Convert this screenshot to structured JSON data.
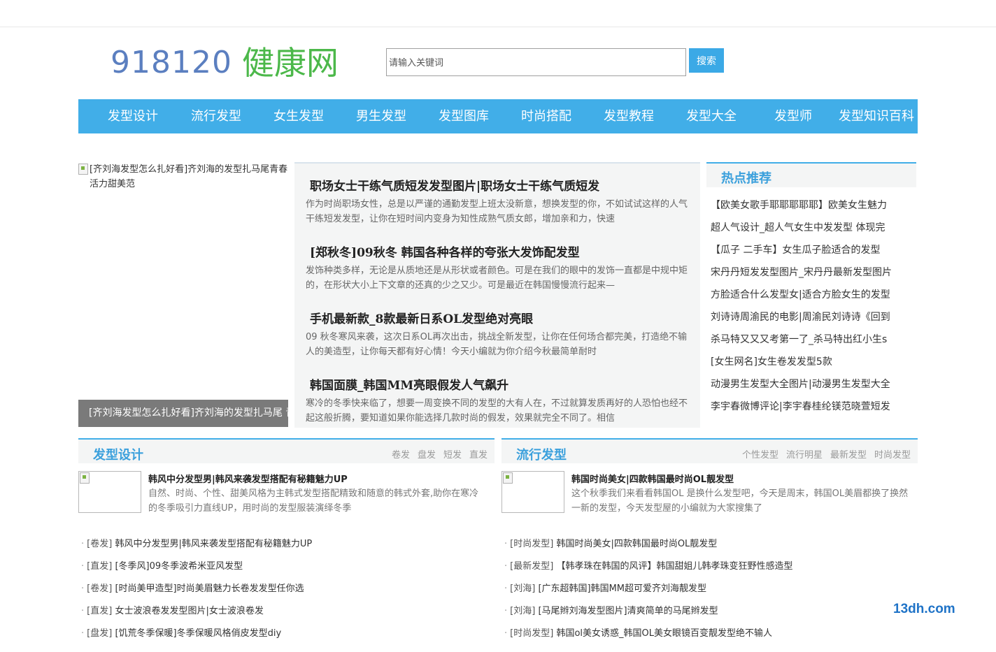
{
  "header": {
    "logo_number": "918120",
    "logo_text": "健康网",
    "search_placeholder": "请输入关键词",
    "search_button": "搜索"
  },
  "nav": {
    "items": [
      "发型设计",
      "流行发型",
      "女生发型",
      "男生发型",
      "发型图库",
      "时尚搭配",
      "发型教程",
      "发型大全",
      "发型师",
      "发型知识百科"
    ]
  },
  "slide": {
    "image_alt": "[齐刘海发型怎么扎好看]齐刘海的发型扎马尾青春活力甜美范",
    "caption": "[齐刘海发型怎么扎好看]齐刘海的发型扎马尾 青春活力甜美范"
  },
  "center": {
    "articles": [
      {
        "title": "职场女士干练气质短发发型图片|职场女士干练气质短发",
        "desc": "作为时尚职场女性，总是以严谨的通勤发型上班太没新意，想换发型的你，不如试试这样的人气干练短发发型，让你在短时间内变身为知性成熟气质女郎，增加亲和力，快速"
      },
      {
        "title": "[郑秋冬]09秋冬 韩国各种各样的夸张大发饰配发型",
        "desc": "发饰种类多样，无论是从质地还是从形状或者颜色。可是在我们的眼中的发饰一直都是中规中矩的，在形状大小上下文章的还真的少之又少。可是最近在韩国慢慢流行起来—"
      },
      {
        "title": "手机最新款_8款最新日系OL发型绝对亮眼",
        "desc": "09 秋冬寒风来袭，这次日系OL再次出击，挑战全新发型，让你在任何场合都完美，打造绝不输人的美造型，让你每天都有好心情！今天小编就为你介绍今秋最简单耐时"
      },
      {
        "title": "韩国面膜_韩国MM亮眼假发人气飙升",
        "desc": "寒冷的冬季快来临了，想要一周变换不同的发型的大有人在，不过就算发质再好的人恐怕也经不起这般折腾，要知道如果你能选择几款时尚的假发，效果就完全不同了。相信"
      }
    ]
  },
  "hot": {
    "title": "热点推荐",
    "items": [
      "【欧美女歌手耶耶耶耶耶】欧美女生魅力",
      "超人气设计_超人气女生中发发型 体现完",
      "【瓜子 二手车】女生瓜子脸适合的发型",
      "宋丹丹短发发型图片_宋丹丹最新发型图片",
      "方脸适合什么发型女|适合方脸女生的发型",
      "刘诗诗周渝民的电影|周渝民刘诗诗《回到",
      "杀马特又又又考第一了_杀马特出红小生s",
      "[女生网名]女生卷发发型5款",
      "动漫男生发型大全图片|动漫男生发型大全",
      "李宇春微博评论|李宇春桂纶镁范晓萱短发"
    ]
  },
  "sections": [
    {
      "title": "发型设计",
      "tags": [
        "卷发",
        "盘发",
        "短发",
        "直发"
      ],
      "feature_title": "韩风中分发型男|韩风来袭发型搭配有秘籍魅力UP",
      "feature_desc": "自然、时尚、个性、甜美风格为主韩式发型搭配精致和随意的韩式外套,助你在寒冷的冬季吸引力直线UP，用时尚的发型服装演绎冬季",
      "list": [
        {
          "tag": "[卷发]",
          "text": "韩风中分发型男|韩风来袭发型搭配有秘籍魅力UP"
        },
        {
          "tag": "[直发]",
          "text": "[冬季风]09冬季波希米亚风发型"
        },
        {
          "tag": "[卷发]",
          "text": "[时尚美甲造型]时尚美眉魅力长卷发发型任你选"
        },
        {
          "tag": "[直发]",
          "text": "女士波浪卷发发型图片|女士波浪卷发"
        },
        {
          "tag": "[盘发]",
          "text": "[饥荒冬季保暖]冬季保暖风格俏皮发型diy"
        }
      ]
    },
    {
      "title": "流行发型",
      "tags": [
        "个性发型",
        "流行明星",
        "最新发型",
        "时尚发型"
      ],
      "feature_title": "韩国时尚美女|四款韩国最时尚OL靓发型",
      "feature_desc": "这个秋季我们来看看韩国OL 是换什么发型吧，今天是周末，韩国OL美眉都换了换然一新的发型，今天发型屋的小编就为大家搜集了",
      "list": [
        {
          "tag": "[时尚发型]",
          "text": "韩国时尚美女|四款韩国最时尚OL靓发型"
        },
        {
          "tag": "[最新发型]",
          "text": "【韩孝珠在韩国的风评】韩国甜姐儿韩孝珠变狂野性感造型"
        },
        {
          "tag": "[刘海]",
          "text": "[广东超韩国]韩国MM超可爱齐刘海靓发型"
        },
        {
          "tag": "[刘海]",
          "text": "[马尾辫刘海发型图片]清爽简单的马尾辫发型"
        },
        {
          "tag": "[时尚发型]",
          "text": "韩国ol美女诱惑_韩国OL美女眼镜百变靓发型绝不输人"
        }
      ]
    }
  ],
  "watermark": "13dh.com"
}
